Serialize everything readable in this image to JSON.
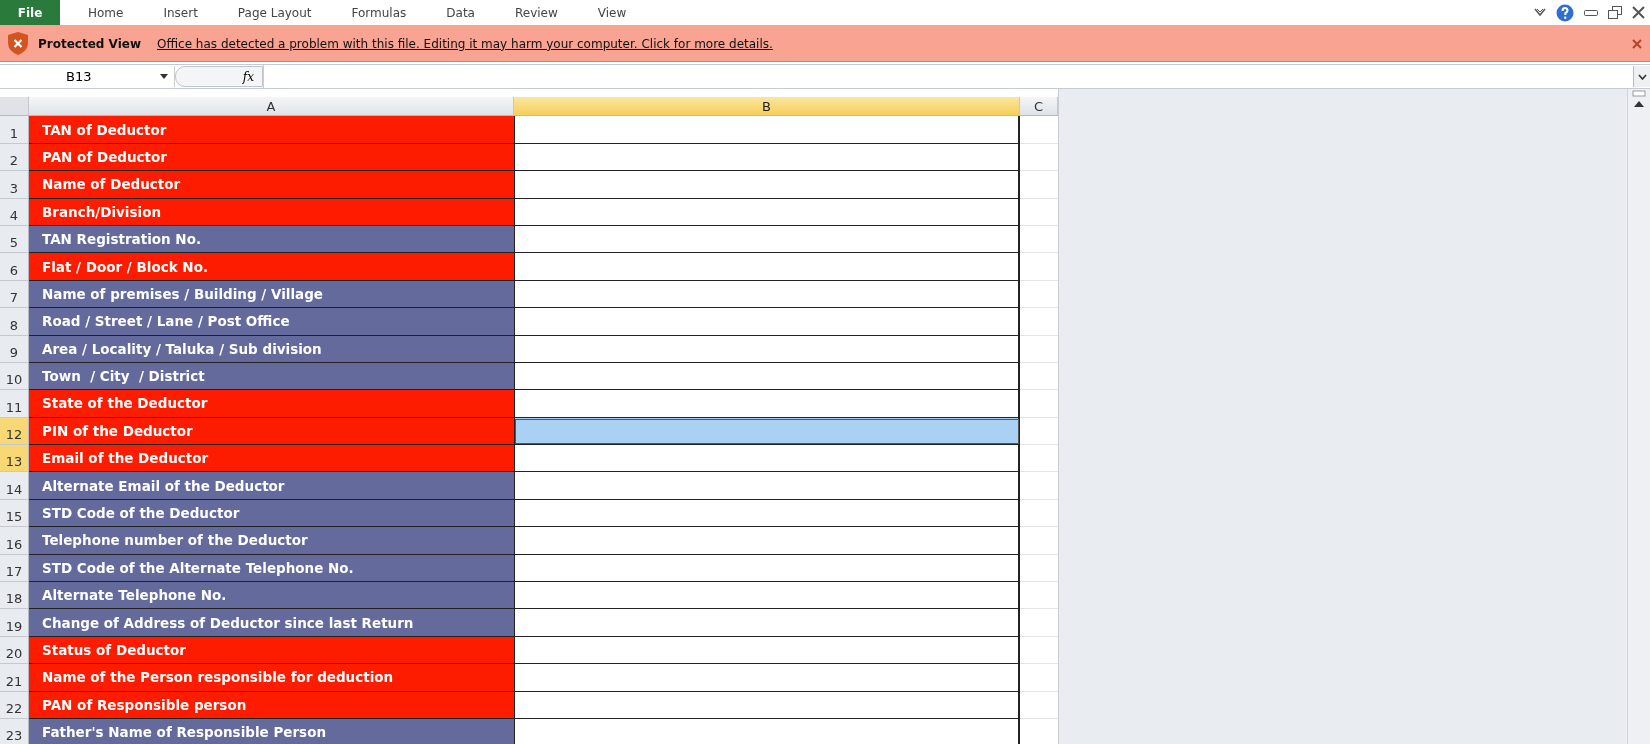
{
  "ribbon": {
    "file_tab": "File",
    "tabs": [
      {
        "label": "Home",
        "selected": false
      },
      {
        "label": "Insert",
        "selected": false
      },
      {
        "label": "Page Layout",
        "selected": false
      },
      {
        "label": "Formulas",
        "selected": false
      },
      {
        "label": "Data",
        "selected": false
      },
      {
        "label": "Review",
        "selected": false
      },
      {
        "label": "View",
        "selected": false
      }
    ]
  },
  "protected_view": {
    "title": "Protected View",
    "message": "Office has detected a problem with this file. Editing it may harm your computer. Click for more details."
  },
  "formula_bar": {
    "name_box": "B13",
    "fx": "fx"
  },
  "columns": [
    {
      "label": "A",
      "selected": false
    },
    {
      "label": "B",
      "selected": true
    },
    {
      "label": "C",
      "selected": false
    }
  ],
  "rows": [
    {
      "number": "1",
      "label": "TAN of Deductor",
      "color": "#fe1c00",
      "selected": false,
      "highlighted": false
    },
    {
      "number": "2",
      "label": "PAN of Deductor",
      "color": "#fe1c00",
      "selected": false,
      "highlighted": false
    },
    {
      "number": "3",
      "label": "Name of Deductor",
      "color": "#fe1c00",
      "selected": false,
      "highlighted": false
    },
    {
      "number": "4",
      "label": "Branch/Division",
      "color": "#fe1c00",
      "selected": false,
      "highlighted": false
    },
    {
      "number": "5",
      "label": "TAN Registration No.",
      "color": "#646a9c",
      "selected": false,
      "highlighted": false
    },
    {
      "number": "6",
      "label": "Flat / Door / Block No.",
      "color": "#fe1c00",
      "selected": false,
      "highlighted": false
    },
    {
      "number": "7",
      "label": "Name of premises / Building / Village",
      "color": "#646a9c",
      "selected": false,
      "highlighted": false
    },
    {
      "number": "8",
      "label": "Road / Street / Lane / Post Office",
      "color": "#646a9c",
      "selected": false,
      "highlighted": false
    },
    {
      "number": "9",
      "label": "Area / Locality / Taluka / Sub division",
      "color": "#646a9c",
      "selected": false,
      "highlighted": false
    },
    {
      "number": "10",
      "label": "Town  / City  / District",
      "color": "#646a9c",
      "selected": false,
      "highlighted": false
    },
    {
      "number": "11",
      "label": "State of the Deductor",
      "color": "#fe1c00",
      "selected": false,
      "highlighted": false
    },
    {
      "number": "12",
      "label": "PIN of the Deductor",
      "color": "#fe1c00",
      "selected": true,
      "highlighted": true
    },
    {
      "number": "13",
      "label": "Email of the Deductor",
      "color": "#fe1c00",
      "selected": true,
      "highlighted": false
    },
    {
      "number": "14",
      "label": "Alternate Email of the Deductor",
      "color": "#646a9c",
      "selected": false,
      "highlighted": false
    },
    {
      "number": "15",
      "label": "STD Code of the Deductor",
      "color": "#646a9c",
      "selected": false,
      "highlighted": false
    },
    {
      "number": "16",
      "label": "Telephone number of the Deductor",
      "color": "#646a9c",
      "selected": false,
      "highlighted": false
    },
    {
      "number": "17",
      "label": "STD Code of the Alternate Telephone No.",
      "color": "#646a9c",
      "selected": false,
      "highlighted": false
    },
    {
      "number": "18",
      "label": "Alternate Telephone No.",
      "color": "#646a9c",
      "selected": false,
      "highlighted": false
    },
    {
      "number": "19",
      "label": "Change of Address of Deductor since last Return",
      "color": "#646a9c",
      "selected": false,
      "highlighted": false
    },
    {
      "number": "20",
      "label": "Status of Deductor",
      "color": "#fe1c00",
      "selected": false,
      "highlighted": false
    },
    {
      "number": "21",
      "label": "Name of the Person responsible for deduction",
      "color": "#fe1c00",
      "selected": false,
      "highlighted": false
    },
    {
      "number": "22",
      "label": "PAN of Responsible person",
      "color": "#fe1c00",
      "selected": false,
      "highlighted": false
    },
    {
      "number": "23",
      "label": "Father's Name of Responsible Person",
      "color": "#646a9c",
      "selected": false,
      "highlighted": false
    }
  ]
}
